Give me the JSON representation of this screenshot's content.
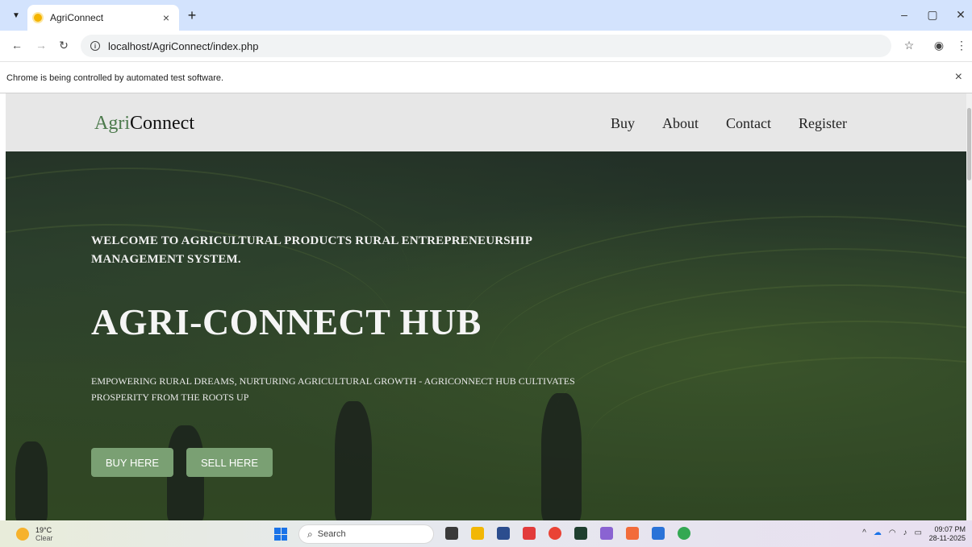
{
  "browser": {
    "tab_title": "AgriConnect",
    "tab_close": "×",
    "new_tab": "+",
    "url": "localhost/AgriConnect/index.php",
    "infobar_message": "Chrome is being controlled by automated test software.",
    "infobar_close": "×"
  },
  "site": {
    "logo_part1": "Agri",
    "logo_part2": "Connect",
    "nav": [
      "Buy",
      "About",
      "Contact",
      "Register"
    ]
  },
  "hero": {
    "welcome": "WELCOME TO AGRICULTURAL PRODUCTS RURAL ENTREPRENEURSHIP MANAGEMENT SYSTEM.",
    "title": "AGRI-CONNECT HUB",
    "tagline": "EMPOWERING RURAL DREAMS, NURTURING AGRICULTURAL GROWTH - AGRICONNECT HUB CULTIVATES PROSPERITY FROM THE ROOTS UP",
    "buy_button": "BUY HERE",
    "sell_button": "SELL HERE"
  },
  "taskbar": {
    "weather_temp": "19°C",
    "weather_cond": "Clear",
    "search_placeholder": "Search",
    "time": "09:07 PM",
    "date": "28-11-2025"
  },
  "colors": {
    "accent_green": "#7aa073",
    "logo_accent": "#4c7a4c",
    "tabstrip": "#d3e3fd"
  }
}
